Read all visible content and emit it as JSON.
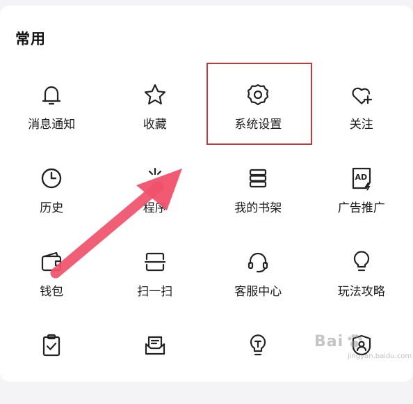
{
  "section": {
    "title": "常用"
  },
  "items": [
    {
      "label": "消息通知",
      "icon": "bell-icon"
    },
    {
      "label": "收藏",
      "icon": "star-icon"
    },
    {
      "label": "系统设置",
      "icon": "gear-icon"
    },
    {
      "label": "关注",
      "icon": "heart-plus-icon"
    },
    {
      "label": "历史",
      "icon": "clock-icon"
    },
    {
      "label": "程序",
      "icon": "mini-program-icon"
    },
    {
      "label": "我的书架",
      "icon": "bookshelf-icon"
    },
    {
      "label": "广告推广",
      "icon": "ad-icon"
    },
    {
      "label": "钱包",
      "icon": "wallet-icon"
    },
    {
      "label": "扫一扫",
      "icon": "scan-icon"
    },
    {
      "label": "客服中心",
      "icon": "headset-icon"
    },
    {
      "label": "玩法攻略",
      "icon": "lightbulb-icon"
    },
    {
      "label": "",
      "icon": "clipboard-check-icon"
    },
    {
      "label": "",
      "icon": "message-box-icon"
    },
    {
      "label": "",
      "icon": "bulb-t-icon"
    },
    {
      "label": "",
      "icon": "shield-user-icon"
    }
  ],
  "colors": {
    "highlight": "#c0393b",
    "arrow": "#f0516a"
  },
  "watermark": {
    "text": "Bai",
    "sub": "jingyan.baidu.com"
  }
}
